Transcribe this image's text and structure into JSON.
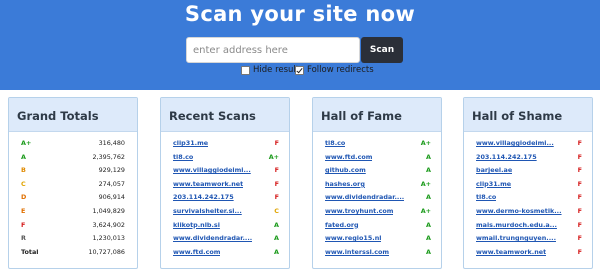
{
  "header": {
    "title": "Scan your site now",
    "address_placeholder": "enter address here",
    "scan_label": "Scan",
    "hide_results": {
      "label": "Hide results",
      "checked": false
    },
    "follow_redirects": {
      "label": "Follow redirects",
      "checked": true
    }
  },
  "grade_colors": {
    "A+": "#1c9b1c",
    "A": "#1c9b1c",
    "B": "#e08a00",
    "C": "#e0a400",
    "D": "#e07000",
    "E": "#e07000",
    "F": "#d61f1f",
    "R": "#555555"
  },
  "grand_totals": {
    "title": "Grand Totals",
    "rows": [
      {
        "grade": "A+",
        "count": "316,480"
      },
      {
        "grade": "A",
        "count": "2,395,762"
      },
      {
        "grade": "B",
        "count": "929,129"
      },
      {
        "grade": "C",
        "count": "274,057"
      },
      {
        "grade": "D",
        "count": "906,914"
      },
      {
        "grade": "E",
        "count": "1,049,829"
      },
      {
        "grade": "F",
        "count": "3,624,902"
      },
      {
        "grade": "R",
        "count": "1,230,013"
      }
    ],
    "total_label": "Total",
    "total_count": "10,727,086"
  },
  "recent_scans": {
    "title": "Recent Scans",
    "rows": [
      {
        "site": "clip31.me",
        "grade": "F"
      },
      {
        "site": "tl8.co",
        "grade": "A+"
      },
      {
        "site": "www.villaggiodeimi...",
        "grade": "F"
      },
      {
        "site": "www.teamwork.net",
        "grade": "F"
      },
      {
        "site": "203.114.242.175",
        "grade": "F"
      },
      {
        "site": "survivalshelter.si...",
        "grade": "C"
      },
      {
        "site": "klikotp.nlb.si",
        "grade": "A"
      },
      {
        "site": "www.dividendradar....",
        "grade": "A"
      },
      {
        "site": "www.ftd.com",
        "grade": "A"
      }
    ]
  },
  "hall_of_fame": {
    "title": "Hall of Fame",
    "rows": [
      {
        "site": "tl8.co",
        "grade": "A+"
      },
      {
        "site": "www.ftd.com",
        "grade": "A"
      },
      {
        "site": "github.com",
        "grade": "A"
      },
      {
        "site": "hashes.org",
        "grade": "A+"
      },
      {
        "site": "www.dividendradar....",
        "grade": "A"
      },
      {
        "site": "www.troyhunt.com",
        "grade": "A+"
      },
      {
        "site": "fated.org",
        "grade": "A"
      },
      {
        "site": "www.regio15.nl",
        "grade": "A"
      },
      {
        "site": "www.interssl.com",
        "grade": "A"
      }
    ]
  },
  "hall_of_shame": {
    "title": "Hall of Shame",
    "rows": [
      {
        "site": "www.villaggiodeimi...",
        "grade": "F"
      },
      {
        "site": "203.114.242.175",
        "grade": "F"
      },
      {
        "site": "barjeel.ae",
        "grade": "F"
      },
      {
        "site": "clip31.me",
        "grade": "F"
      },
      {
        "site": "tl8.co",
        "grade": "F"
      },
      {
        "site": "www.dermo-kosmetik...",
        "grade": "F"
      },
      {
        "site": "mais.murdoch.edu.a...",
        "grade": "F"
      },
      {
        "site": "wmail.trungnguyen....",
        "grade": "F"
      },
      {
        "site": "www.teamwork.net",
        "grade": "F"
      }
    ]
  }
}
